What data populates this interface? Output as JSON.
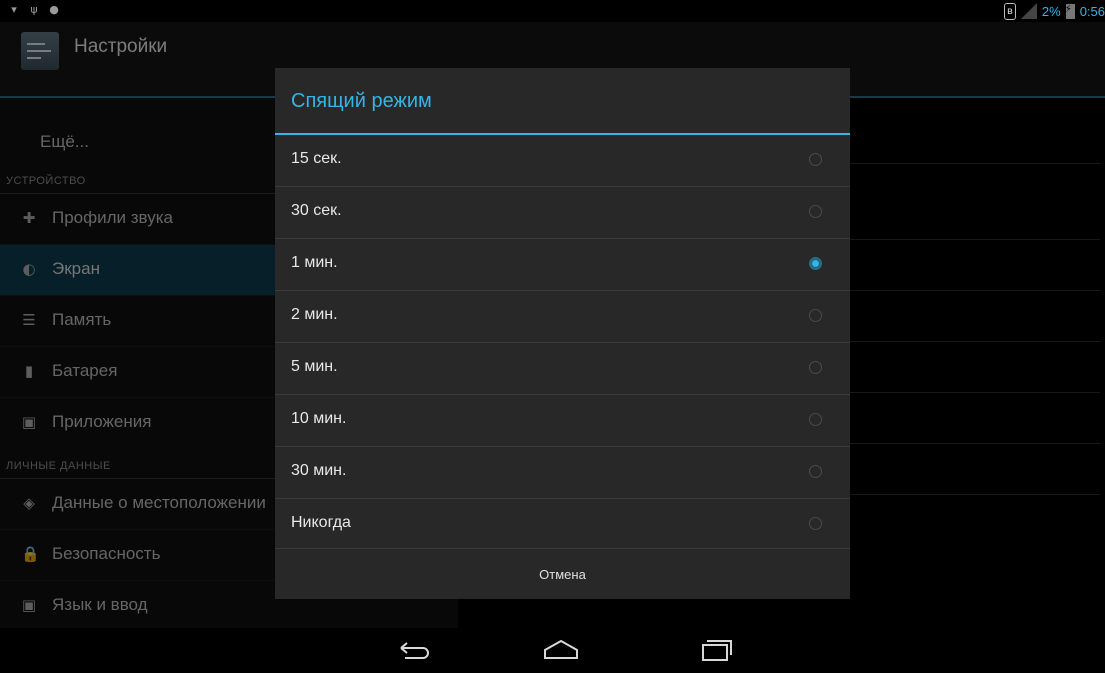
{
  "status_bar": {
    "battery_percent": "2%",
    "time": "0:56",
    "left_icons": [
      "wifi-icon",
      "usb-icon",
      "android-debug-icon"
    ],
    "right_icons": [
      "bluetooth-icon",
      "signal-icon",
      "battery-charging-icon"
    ]
  },
  "action_bar": {
    "title": "Настройки",
    "icon": "settings-app-icon"
  },
  "settings_list": {
    "more_label": "Ещё...",
    "device_header": "УСТРОЙСТВО",
    "device_items": [
      {
        "label": "Профили звука",
        "icon": "sound-profiles-icon"
      },
      {
        "label": "Экран",
        "icon": "display-icon",
        "selected": true
      },
      {
        "label": "Память",
        "icon": "storage-icon"
      },
      {
        "label": "Батарея",
        "icon": "battery-icon"
      },
      {
        "label": "Приложения",
        "icon": "apps-icon"
      }
    ],
    "personal_header": "ЛИЧНЫЕ ДАННЫЕ",
    "personal_items": [
      {
        "label": "Данные о местоположении",
        "icon": "location-icon"
      },
      {
        "label": "Безопасность",
        "icon": "lock-icon"
      },
      {
        "label": "Язык и ввод",
        "icon": "language-icon"
      }
    ]
  },
  "dialog": {
    "title": "Спящий режим",
    "options": [
      {
        "label": "15 сек.",
        "checked": false
      },
      {
        "label": "30 сек.",
        "checked": false
      },
      {
        "label": "1 мин.",
        "checked": true
      },
      {
        "label": "2 мин.",
        "checked": false
      },
      {
        "label": "5 мин.",
        "checked": false
      },
      {
        "label": "10 мин.",
        "checked": false
      },
      {
        "label": "30 мин.",
        "checked": false
      },
      {
        "label": "Никогда",
        "checked": false
      }
    ],
    "cancel_label": "Отмена"
  },
  "nav_bar": {
    "icons": [
      "back-icon",
      "home-icon",
      "recent-apps-icon"
    ]
  },
  "colors": {
    "accent": "#33b5e5",
    "selected_row": "#0b3a4c",
    "dialog_bg": "#282828"
  }
}
